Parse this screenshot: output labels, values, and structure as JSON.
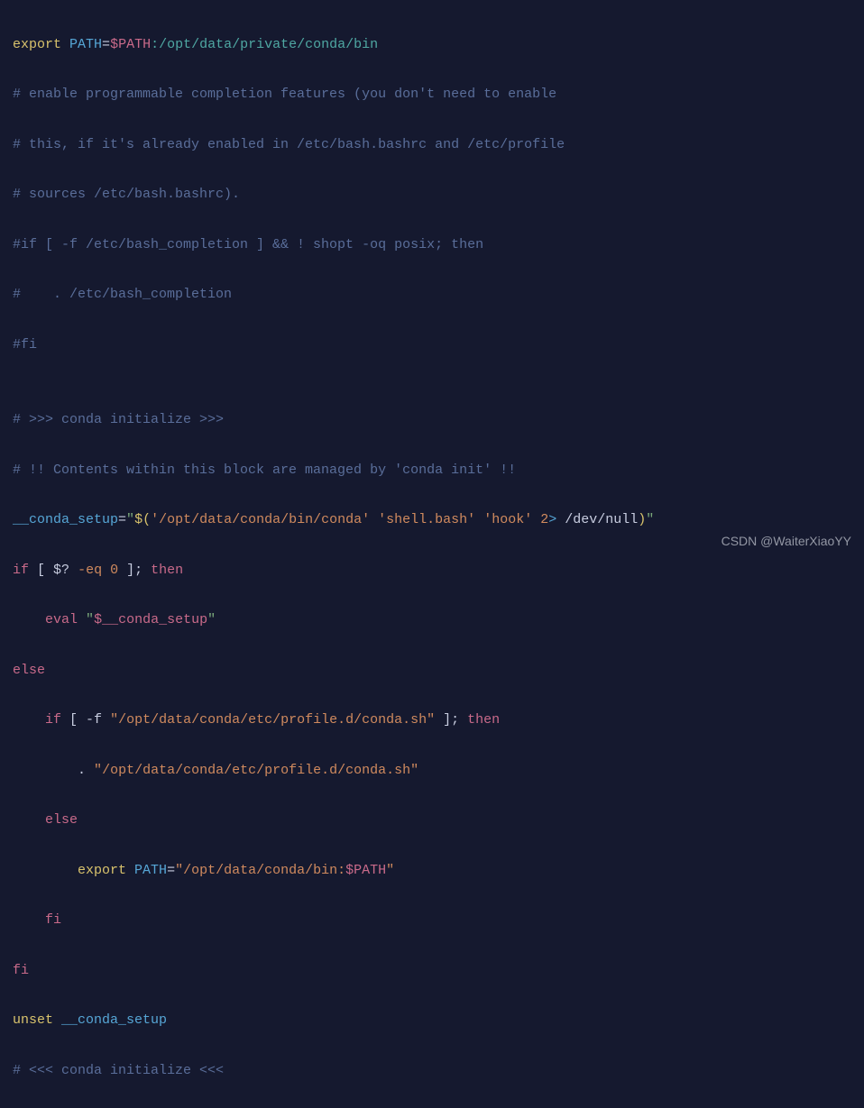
{
  "code": {
    "l1": {
      "export": "export",
      "path_var": "PATH",
      "eq": "=",
      "path_val": "$PATH",
      "colon": ":",
      "path_lit": "/opt/data/private/conda/bin"
    },
    "l2": "# enable programmable completion features (you don't need to enable",
    "l3": "# this, if it's already enabled in /etc/bash.bashrc and /etc/profile",
    "l4": "# sources /etc/bash.bashrc).",
    "l5": "#if [ -f /etc/bash_completion ] && ! shopt -oq posix; then",
    "l6": "#    . /etc/bash_completion",
    "l7": "#fi",
    "l8": "",
    "l9": "# >>> conda initialize >>>",
    "l10": "# !! Contents within this block are managed by 'conda init' !!",
    "l11": {
      "var": "__conda_setup",
      "eq": "=",
      "q": "\"",
      "dollar_open": "$(",
      "s1": "'/opt/data/conda/bin/conda'",
      "sp1": " ",
      "s2": "'shell.bash'",
      "sp2": " ",
      "s3": "'hook'",
      "sp3": " ",
      "num": "2",
      "redir": ">",
      "sp4": " ",
      "devnull": "/dev/null",
      "close": ")",
      "q2": "\""
    },
    "l12": {
      "if": "if",
      "open": " [ ",
      "d": "$",
      "q": "?",
      "op": " -eq ",
      "n": "0",
      "close": " ]; ",
      "then": "then"
    },
    "l13": {
      "indent": "    ",
      "eval": "eval",
      "sp": " ",
      "q1": "\"",
      "d": "$",
      "var": "__conda_setup",
      "q2": "\""
    },
    "l14": "else",
    "l15": {
      "indent": "    ",
      "if": "if",
      "open": " [ ",
      "flag": "-f ",
      "q1": "\"",
      "path": "/opt/data/conda/etc/profile.d/conda.sh",
      "q2": "\"",
      "close": " ]; ",
      "then": "then"
    },
    "l16": {
      "indent": "        ",
      "dot": ".",
      "sp": " ",
      "q1": "\"",
      "path": "/opt/data/conda/etc/profile.d/conda.sh",
      "q2": "\""
    },
    "l17": {
      "indent": "    ",
      "else": "else"
    },
    "l18": {
      "indent": "        ",
      "export": "export",
      "sp": " ",
      "var": "PATH",
      "eq": "=",
      "q1": "\"",
      "path": "/opt/data/conda/bin:",
      "d": "$PATH",
      "q2": "\""
    },
    "l19": {
      "indent": "    ",
      "fi": "fi"
    },
    "l20": "fi",
    "l21": {
      "unset": "unset",
      "sp": " ",
      "var": "__conda_setup"
    },
    "l22": "# <<< conda initialize <<<"
  },
  "watermark": "CSDN @WaiterXiaoYY"
}
